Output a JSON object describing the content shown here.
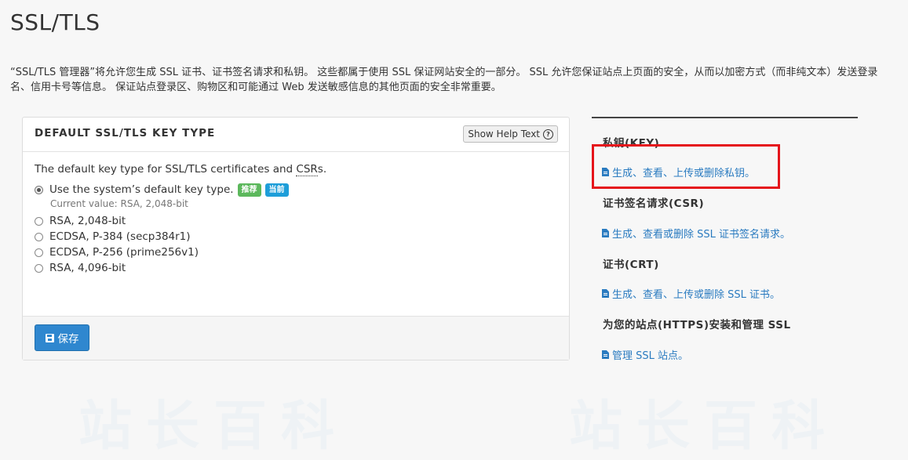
{
  "page": {
    "title": "SSL/TLS",
    "intro": "“SSL/TLS 管理器”将允许您生成 SSL 证书、证书签名请求和私钥。 这些都属于使用 SSL 保证网站安全的一部分。 SSL 允许您保证站点上页面的安全，从而以加密方式（而非纯文本）发送登录名、信用卡号等信息。 保证站点登录区、购物区和可能通过 Web 发送敏感信息的其他页面的安全非常重要。"
  },
  "watermarks": [
    "站长百科",
    "站长百科",
    "站长百科"
  ],
  "key_type_panel": {
    "title": "DEFAULT SSL/TLS KEY TYPE",
    "help_button": "Show Help Text",
    "description_prefix": "The default key type for SSL/TLS certificates and ",
    "description_abbr": "CSR",
    "description_suffix": "s.",
    "options": [
      {
        "label": "Use the system’s default key type.",
        "checked": true
      },
      {
        "label": "RSA, 2,048-bit",
        "checked": false
      },
      {
        "label": "ECDSA, P-384 (secp384r1)",
        "checked": false
      },
      {
        "label": "ECDSA, P-256 (prime256v1)",
        "checked": false
      },
      {
        "label": "RSA, 4,096-bit",
        "checked": false
      }
    ],
    "badges": [
      {
        "label": "推荐",
        "color": "#5cb85c"
      },
      {
        "label": "当前",
        "color": "#1e9ed9"
      }
    ],
    "current_value": "Current value: RSA, 2,048-bit",
    "save_label": "保存"
  },
  "sidebar": {
    "sections": [
      {
        "title": "私钥(KEY)",
        "link": "生成、查看、上传或删除私钥。"
      },
      {
        "title": "证书签名请求(CSR)",
        "link": "生成、查看或删除 SSL 证书签名请求。"
      },
      {
        "title": "证书(CRT)",
        "link": "生成、查看、上传或删除 SSL 证书。"
      },
      {
        "title": "为您的站点(HTTPS)安装和管理 SSL",
        "link": "管理 SSL 站点。"
      }
    ]
  },
  "colors": {
    "link": "#2a7bc0",
    "primary_button": "#2f87cf",
    "highlight": "#e5141b"
  }
}
